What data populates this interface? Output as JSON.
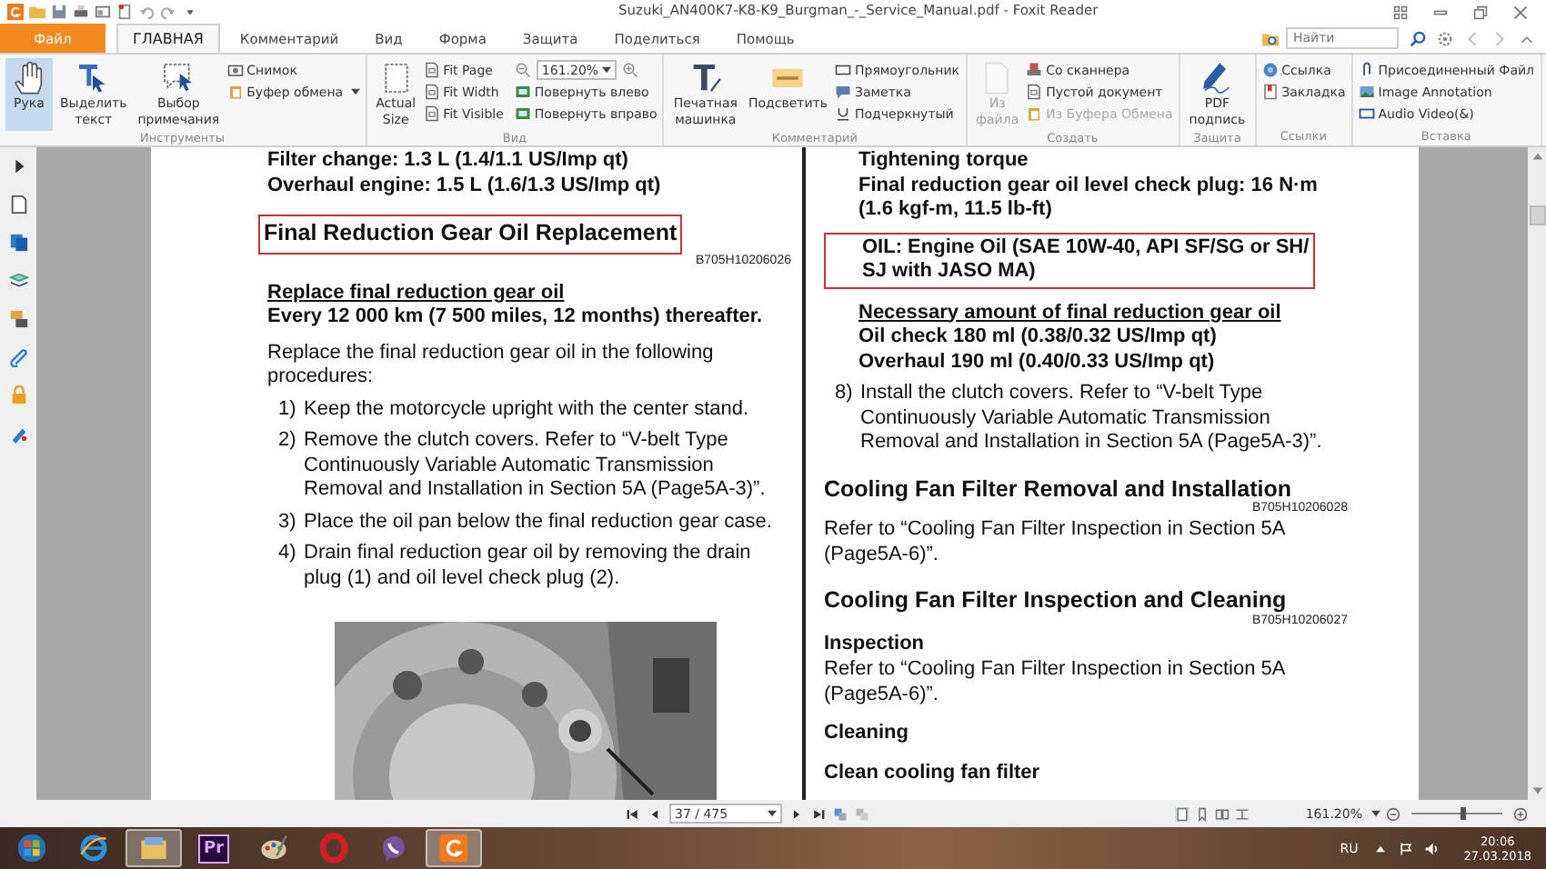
{
  "window": {
    "title": "Suzuki_AN400K7-K8-K9_Burgman_-_Service_Manual.pdf - Foxit Reader"
  },
  "menu_tabs": [
    {
      "label": "Файл",
      "kind": "file",
      "selected": false
    },
    {
      "label": "ГЛАВНАЯ",
      "kind": "tab",
      "selected": true
    },
    {
      "label": "Комментарий",
      "kind": "tab",
      "selected": false
    },
    {
      "label": "Вид",
      "kind": "tab",
      "selected": false
    },
    {
      "label": "Форма",
      "kind": "tab",
      "selected": false
    },
    {
      "label": "Защита",
      "kind": "tab",
      "selected": false
    },
    {
      "label": "Поделиться",
      "kind": "tab",
      "selected": false
    },
    {
      "label": "Помощь",
      "kind": "tab",
      "selected": false
    }
  ],
  "search": {
    "placeholder": "Найти"
  },
  "ribbon": [
    {
      "label": "Инструменты",
      "buttons": [
        {
          "label": "Рука",
          "selected": true,
          "disabled": false
        },
        {
          "label": "Выделить\nтекст",
          "selected": false,
          "disabled": false
        },
        {
          "label": "Выбор\nпримечания",
          "selected": false,
          "disabled": false
        }
      ],
      "commands": [
        {
          "kind": "command",
          "label": "Снимок",
          "disabled": false
        },
        {
          "kind": "menu",
          "label": "Буфер обмена",
          "disabled": false
        }
      ]
    },
    {
      "label": "Вид",
      "buttons": [
        {
          "label": "Actual\nSize",
          "selected": false,
          "disabled": false
        }
      ],
      "commands": [
        {
          "kind": "command",
          "label": "Fit Page",
          "disabled": false
        },
        {
          "kind": "command",
          "label": "Fit Width",
          "disabled": false
        },
        {
          "kind": "command",
          "label": "Fit Visible",
          "disabled": false
        },
        {
          "kind": "zoom",
          "label": "161.20%",
          "disabled": false
        },
        {
          "kind": "command",
          "label": "Повернуть влево",
          "disabled": false
        },
        {
          "kind": "command",
          "label": "Повернуть вправо",
          "disabled": false
        }
      ]
    },
    {
      "label": "Комментарий",
      "buttons": [
        {
          "label": "Печатная\nмашинка",
          "selected": false,
          "disabled": false
        },
        {
          "label": "Подсветить",
          "selected": false,
          "disabled": false
        }
      ],
      "commands": [
        {
          "kind": "command",
          "label": "Прямоугольник",
          "disabled": false
        },
        {
          "kind": "command",
          "label": "Заметка",
          "disabled": false
        },
        {
          "kind": "command",
          "label": "Подчеркнутый",
          "disabled": false
        }
      ]
    },
    {
      "label": "Создать",
      "buttons": [
        {
          "label": "Из\nфайла",
          "selected": false,
          "disabled": true
        }
      ],
      "commands": [
        {
          "kind": "command",
          "label": "Со сканнера",
          "disabled": false
        },
        {
          "kind": "command",
          "label": "Пустой документ",
          "disabled": false
        },
        {
          "kind": "command",
          "label": "Из Буфера Обмена",
          "disabled": true
        }
      ]
    },
    {
      "label": "Защита",
      "buttons": [
        {
          "label": "PDF\nподпись",
          "selected": false,
          "disabled": false
        }
      ]
    },
    {
      "label": "Ссылки",
      "commands": [
        {
          "kind": "command",
          "label": "Ссылка",
          "disabled": false
        },
        {
          "kind": "command",
          "label": "Закладка",
          "disabled": false
        }
      ]
    },
    {
      "label": "Вставка",
      "commands": [
        {
          "kind": "command",
          "label": "Присоединенный Файл",
          "disabled": false
        },
        {
          "kind": "command",
          "label": "Image Annotation",
          "disabled": false
        },
        {
          "kind": "command",
          "label": "Audio  Video(&)",
          "disabled": false
        }
      ]
    }
  ],
  "document": {
    "pages": [
      {
        "blocks": [
          {
            "kind": "spec",
            "lines": [
              "Filter change: 1.3 L (1.4/1.1 US/Imp qt)",
              "Overhaul engine: 1.5 L (1.6/1.3 US/Imp qt)"
            ]
          },
          {
            "kind": "boxed_heading",
            "lines": [
              "Final Reduction Gear Oil Replacement"
            ]
          },
          {
            "kind": "code",
            "lines": [
              "B705H10206026"
            ]
          },
          {
            "kind": "underlined",
            "lines": [
              "Replace final reduction gear oil"
            ]
          },
          {
            "kind": "bold",
            "lines": [
              "Every 12 000 km (7 500 miles, 12 months) thereafter."
            ]
          },
          {
            "kind": "paragraph",
            "lines": [
              "Replace the final reduction gear oil in the following",
              "procedures:"
            ]
          },
          {
            "kind": "step",
            "number": "1)",
            "lines": [
              "Keep the motorcycle upright with the center stand."
            ]
          },
          {
            "kind": "step",
            "number": "2)",
            "lines": [
              "Remove the clutch covers. Refer to “V-belt Type",
              "Continuously Variable Automatic Transmission",
              "Removal and Installation in Section 5A (Page5A-3)”."
            ]
          },
          {
            "kind": "step",
            "number": "3)",
            "lines": [
              "Place the oil pan below the final reduction gear case."
            ]
          },
          {
            "kind": "step",
            "number": "4)",
            "lines": [
              "Drain final reduction gear oil by removing the drain",
              "plug (1) and oil level check plug (2)."
            ]
          },
          {
            "kind": "picture"
          }
        ]
      },
      {
        "blocks": [
          {
            "kind": "spec",
            "lines": [
              "Tightening torque",
              "Final reduction gear oil level check plug:  16 N·m",
              "(1.6 kgf-m, 11.5 lb-ft)"
            ]
          },
          {
            "kind": "boxed_spec",
            "lines": [
              "OIL:  Engine Oil (SAE 10W-40, API SF/SG or SH/",
              "SJ with JASO MA)"
            ]
          },
          {
            "kind": "underlined_spec",
            "lines": [
              "Necessary amount of final reduction gear oil"
            ]
          },
          {
            "kind": "spec",
            "lines": [
              "Oil check 180 ml (0.38/0.32 US/Imp qt)",
              "Overhaul 190 ml (0.40/0.33 US/Imp qt)"
            ]
          },
          {
            "kind": "step",
            "number": "8)",
            "lines": [
              "Install the clutch covers. Refer to “V-belt Type",
              "Continuously Variable Automatic Transmission",
              "Removal and Installation in Section 5A (Page5A-3)”."
            ]
          },
          {
            "kind": "heading",
            "lines": [
              "Cooling Fan Filter Removal and Installation"
            ]
          },
          {
            "kind": "code",
            "lines": [
              "B705H10206028"
            ]
          },
          {
            "kind": "paragraph",
            "lines": [
              "Refer to “Cooling Fan Filter Inspection in Section 5A",
              "(Page5A-6)”."
            ]
          },
          {
            "kind": "heading",
            "lines": [
              "Cooling Fan Filter Inspection and Cleaning"
            ]
          },
          {
            "kind": "code",
            "lines": [
              "B705H10206027"
            ]
          },
          {
            "kind": "subheading",
            "lines": [
              "Inspection"
            ]
          },
          {
            "kind": "paragraph",
            "lines": [
              "Refer to “Cooling Fan Filter Inspection in Section 5A",
              "(Page5A-6)”."
            ]
          },
          {
            "kind": "subheading_gap",
            "lines": [
              "Cleaning"
            ]
          },
          {
            "kind": "subheading_gap",
            "lines": [
              "Clean cooling fan filter"
            ]
          }
        ]
      }
    ]
  },
  "status_bar": {
    "page_field": "37 / 475",
    "zoom": "161.20%",
    "zoom_slider": {
      "level": 0.55
    }
  },
  "taskbar": {
    "apps": [
      {
        "kind": "start",
        "selected": false
      },
      {
        "kind": "ie",
        "selected": false
      },
      {
        "kind": "explorer",
        "selected": true
      },
      {
        "kind": "premiere",
        "label": "Pr",
        "selected": false
      },
      {
        "kind": "paint",
        "selected": false
      },
      {
        "kind": "opera",
        "selected": false
      },
      {
        "kind": "viber",
        "selected": false
      },
      {
        "kind": "foxit",
        "selected": true
      }
    ],
    "language": "RU",
    "time": "20:06",
    "date": "27.03.2018"
  }
}
